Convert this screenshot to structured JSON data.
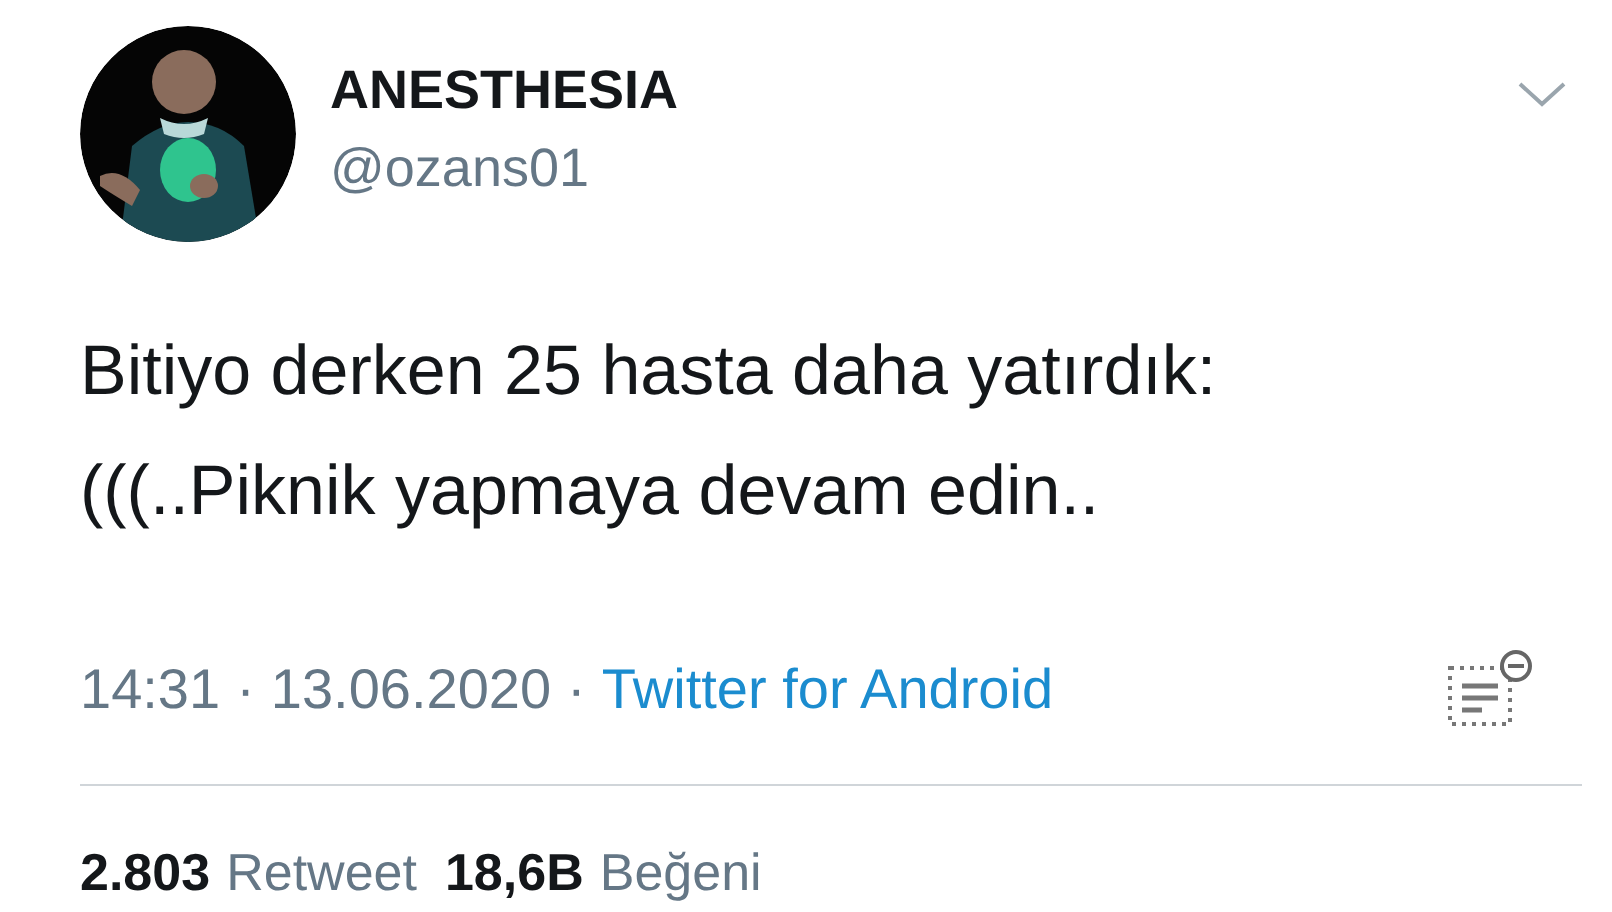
{
  "author": {
    "name": "ANESTHESIA",
    "handle": "@ozans01"
  },
  "text_lines": [
    "Bitiyo derken 25 hasta daha yatırdık:",
    "(((..Piknik yapmaya devam edin.."
  ],
  "meta": {
    "time": "14:31",
    "separator_1": "·",
    "date": "13.06.2020",
    "separator_2": "·",
    "source": "Twitter for Android"
  },
  "stats": [
    {
      "count": "2.803",
      "label": "Retweet"
    },
    {
      "count": "18,6B",
      "label": "Beğeni"
    }
  ]
}
